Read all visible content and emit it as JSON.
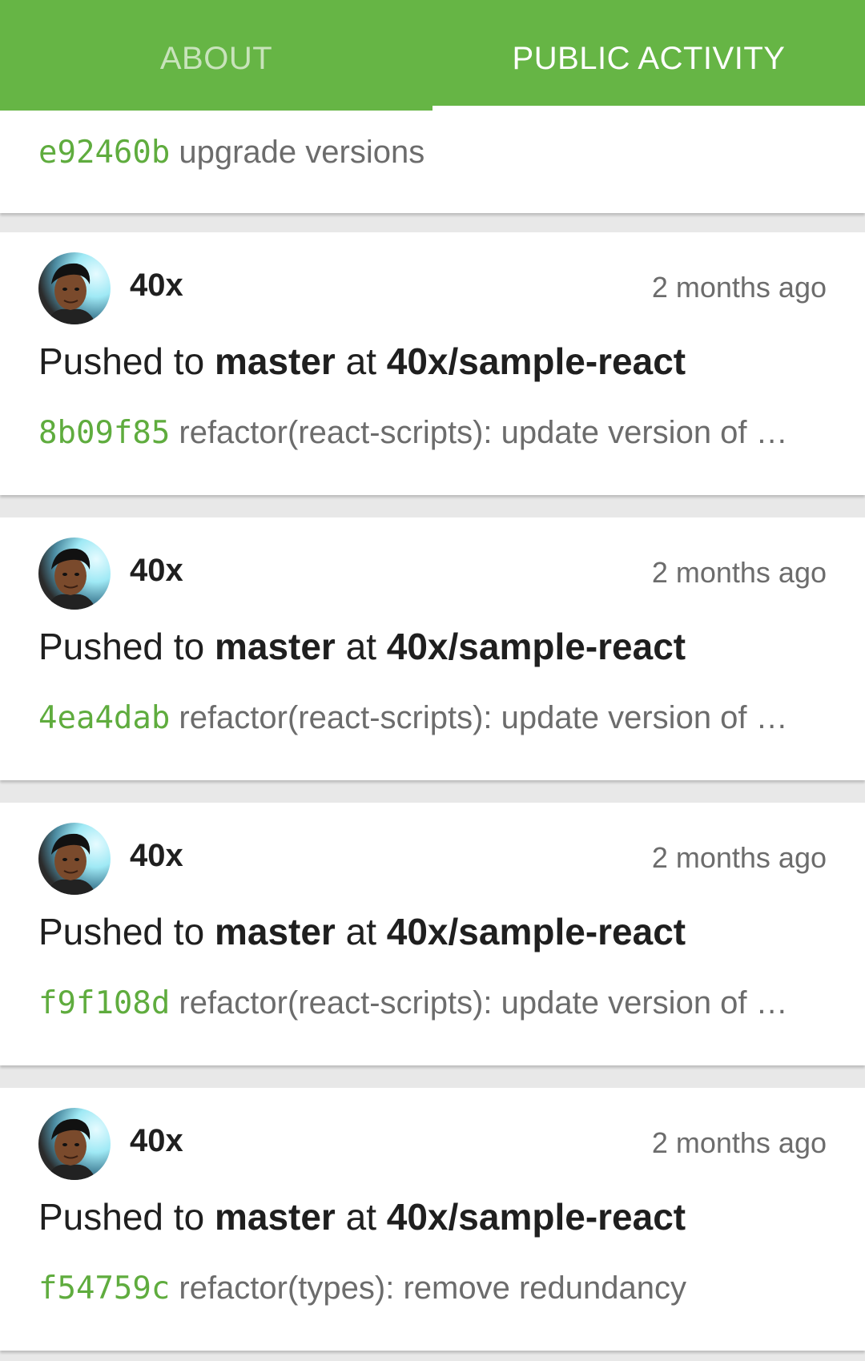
{
  "tabs": [
    {
      "label": "ABOUT",
      "active": false
    },
    {
      "label": "PUBLIC ACTIVITY",
      "active": true
    }
  ],
  "colors": {
    "accent": "#66b545",
    "sha": "#5fac3e"
  },
  "partial_commit": {
    "sha": "e92460b",
    "message": "upgrade versions"
  },
  "events": [
    {
      "user": "40x",
      "time": "2 months ago",
      "action": "Pushed to",
      "branch": "master",
      "preposition": "at",
      "repo": "40x/sample-react",
      "commit_sha": "8b09f85",
      "commit_message": "refactor(react-scripts): update version of …"
    },
    {
      "user": "40x",
      "time": "2 months ago",
      "action": "Pushed to",
      "branch": "master",
      "preposition": "at",
      "repo": "40x/sample-react",
      "commit_sha": "4ea4dab",
      "commit_message": "refactor(react-scripts): update version of …"
    },
    {
      "user": "40x",
      "time": "2 months ago",
      "action": "Pushed to",
      "branch": "master",
      "preposition": "at",
      "repo": "40x/sample-react",
      "commit_sha": "f9f108d",
      "commit_message": "refactor(react-scripts): update version of …"
    },
    {
      "user": "40x",
      "time": "2 months ago",
      "action": "Pushed to",
      "branch": "master",
      "preposition": "at",
      "repo": "40x/sample-react",
      "commit_sha": "f54759c",
      "commit_message": "refactor(types): remove redundancy"
    }
  ]
}
